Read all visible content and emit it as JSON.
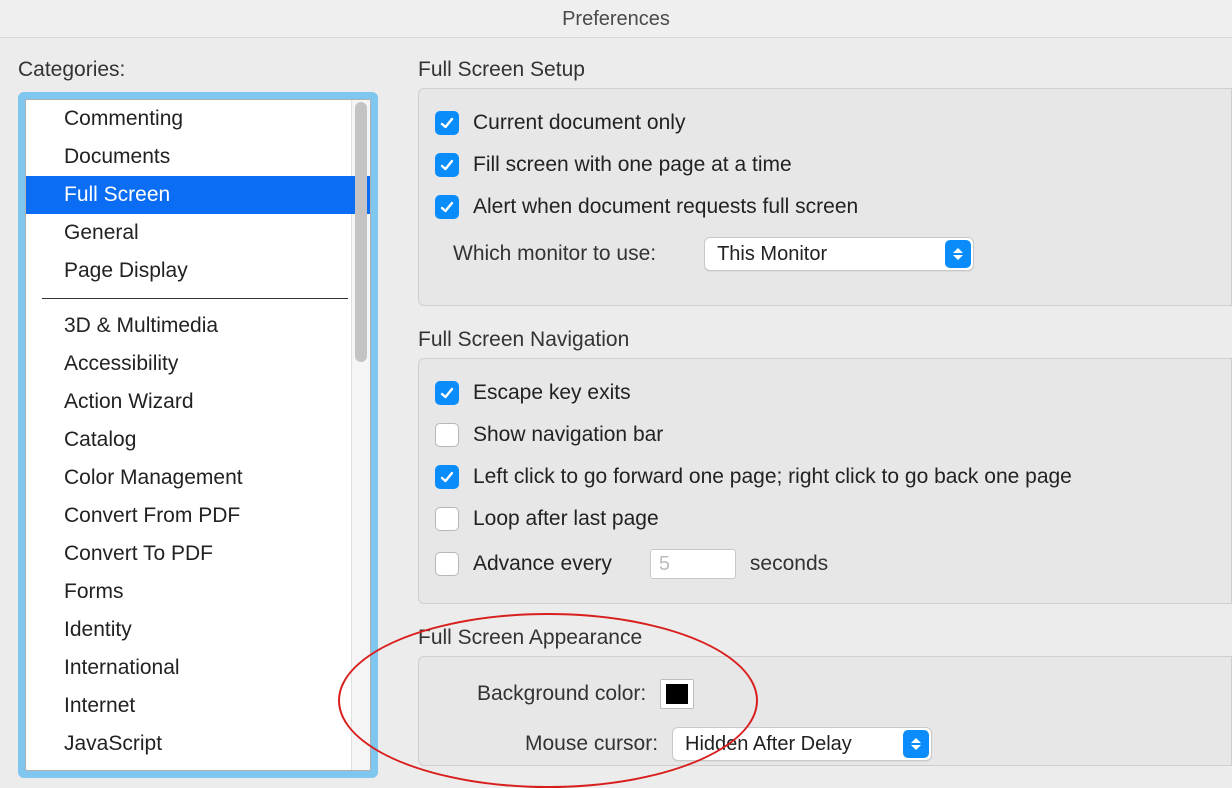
{
  "window": {
    "title": "Preferences"
  },
  "sidebar": {
    "label": "Categories:",
    "group1": [
      {
        "label": "Commenting"
      },
      {
        "label": "Documents"
      },
      {
        "label": "Full Screen",
        "selected": true
      },
      {
        "label": "General"
      },
      {
        "label": "Page Display"
      }
    ],
    "group2": [
      {
        "label": "3D & Multimedia"
      },
      {
        "label": "Accessibility"
      },
      {
        "label": "Action Wizard"
      },
      {
        "label": "Catalog"
      },
      {
        "label": "Color Management"
      },
      {
        "label": "Convert From PDF"
      },
      {
        "label": "Convert To PDF"
      },
      {
        "label": "Forms"
      },
      {
        "label": "Identity"
      },
      {
        "label": "International"
      },
      {
        "label": "Internet"
      },
      {
        "label": "JavaScript"
      }
    ]
  },
  "setup": {
    "title": "Full Screen Setup",
    "current_document_only": {
      "label": "Current document only",
      "checked": true
    },
    "fill_screen": {
      "label": "Fill screen with one page at a time",
      "checked": true
    },
    "alert_full_screen": {
      "label": "Alert when document requests full screen",
      "checked": true
    },
    "monitor_label": "Which monitor to use:",
    "monitor_value": "This Monitor"
  },
  "navigation": {
    "title": "Full Screen Navigation",
    "escape_exits": {
      "label": "Escape key exits",
      "checked": true
    },
    "show_nav_bar": {
      "label": "Show navigation bar",
      "checked": false
    },
    "click_paging": {
      "label": "Left click to go forward one page; right click to go back one page",
      "checked": true
    },
    "loop": {
      "label": "Loop after last page",
      "checked": false
    },
    "advance": {
      "label": "Advance every",
      "checked": false,
      "value": "5",
      "unit": "seconds"
    }
  },
  "appearance": {
    "title": "Full Screen Appearance",
    "bg_label": "Background color:",
    "bg_color": "#000000",
    "cursor_label": "Mouse cursor:",
    "cursor_value": "Hidden After Delay"
  }
}
